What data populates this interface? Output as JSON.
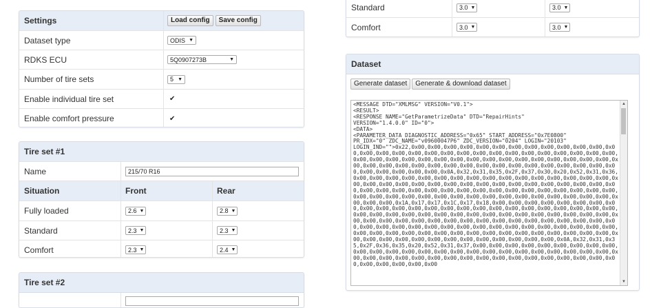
{
  "settings": {
    "title": "Settings",
    "load_label": "Load config",
    "save_label": "Save config",
    "rows": [
      {
        "label": "Dataset type",
        "value": "ODIS",
        "kind": "select"
      },
      {
        "label": "RDKS ECU",
        "value": "5Q0907273B",
        "kind": "select"
      },
      {
        "label": "Number of tire sets",
        "value": "5",
        "kind": "select"
      },
      {
        "label": "Enable individual tire set",
        "value": "✔",
        "kind": "check"
      },
      {
        "label": "Enable comfort pressure",
        "value": "✔",
        "kind": "check"
      }
    ]
  },
  "top_table": {
    "rows": [
      {
        "label": "Standard",
        "front": "3.0",
        "rear": "3.0"
      },
      {
        "label": "Comfort",
        "front": "3.0",
        "rear": "3.0"
      }
    ]
  },
  "tireset1": {
    "title": "Tire set #1",
    "name_label": "Name",
    "name_value": "215/70 R16",
    "col_situation": "Situation",
    "col_front": "Front",
    "col_rear": "Rear",
    "rows": [
      {
        "label": "Fully loaded",
        "front": "2.6",
        "rear": "2.8"
      },
      {
        "label": "Standard",
        "front": "2.3",
        "rear": "2.3"
      },
      {
        "label": "Comfort",
        "front": "2.3",
        "rear": "2.4"
      }
    ]
  },
  "tireset2": {
    "title": "Tire set #2"
  },
  "dataset": {
    "title": "Dataset",
    "generate_label": "Generate dataset",
    "generate_download_label": "Generate & download dataset",
    "content": "<MESSAGE DTD=\"XMLMSG\" VERSION=\"V0.1\">\n<RESULT>\n<RESPONSE NAME=\"GetParametrizeData\" DTD=\"RepairHints\"\nVERSION=\"1.4.0.0\" ID=\"0\">\n<DATA>\n<PARAMETER_DATA DIAGNOSTIC_ADDRESS=\"0x65\" START_ADDRESS=\"0x7E0800\"\nPR_IDX=\"0\" ZDC_NAME=\"v09600047P6\" ZDC_VERSION=\"0204\" LOGIN=\"20103\"\nLOGIN_IND=\"\">0x22,0x00,0x00,0x00,0x00,0x00,0x00,0x00,0x00,0x00,0x00,0x00,0x00,0x00,0x00,0x00,0x00,0x00,0x00,0x00,0x00,0x00,0x00,0x00,0x00,0x00,0x00,0x00,0x00,0x00,0x00,0x00,0x00,0x00,0x00,0x00,0x00,0x00,0x00,0x00,0x00,0x00,0x00,0x00,0x00,0x00,0x00,0x00,0x00,0x00,0x00,0x00,0x00,0x00,0x00,0x00,0x00,0x00,0x00,0x00,0x00,0x00,0x00,0x00,0x00,0x00,0x00,0x00,0x0A,0x32,0x31,0x35,0x2F,0x37,0x30,0x20,0x52,0x31,0x36,0x00,0x00,0x00,0x00,0x00,0x00,0x00,0x00,0x00,0x00,0x00,0x00,0x00,0x00,0x00,0x00,0x00,0x00,0x00,0x00,0x00,0x00,0x00,0x00,0x00,0x00,0x00,0x00,0x00,0x00,0x00,0x00,0x00,0x00,0x00,0x00,0x00,0x00,0x00,0x00,0x00,0x00,0x00,0x00,0x00,0x00,0x00,0x00,0x00,0x00,0x00,0x00,0x00,0x00,0x00,0x00,0x00,0x00,0x00,0x00,0x00,0x00,0x00,0x00,0x00,0x00,0x00,0x00,0x1A,0x17,0x17,0x1C,0x17,0x18,0x00,0x00,0x00,0x00,0x00,0x00,0x00,0x00,0x00,0x00,0x00,0x00,0x00,0x00,0x00,0x00,0x00,0x00,0x00,0x00,0x00,0x00,0x00,0x00,0x00,0x00,0x00,0x00,0x00,0x00,0x00,0x00,0x00,0x00,0x00,0x00,0x00,0x00,0x00,0x00,0x00,0x00,0x00,0x00,0x00,0x00,0x00,0x00,0x00,0x00,0x00,0x00,0x00,0x00,0x00,0x00,0x00,0x00,0x00,0x00,0x00,0x00,0x00,0x00,0x00,0x00,0x00,0x00,0x00,0x00,0x00,0x00,0x00,0x00,0x00,0x00,0x00,0x00,0x00,0x00,0x00,0x00,0x00,0x00,0x00,0x00,0x00,0x00,0x00,0x00,0x00,0x00,0x00,0x00,0x00,0x00,0x00,0x00,0x00,0x00,0x00,0x00,0x0A,0x32,0x31,0x35,0x2F,0x36,0x35,0x20,0x52,0x31,0x37,0x00,0x00,0x00,0x00,0x00,0x00,0x00,0x00,0x00,0x00,0x00,0x00,0x00,0x00,0x00,0x00,0x00,0x00,0x00,0x00,0x00,0x00,0x00,0x00,0x00,0x00,0x00,0x00,0x00,0x00,0x00,0x00,0x00,0x00,0x00,0x00,0x00,0x00,0x00,0x00,0x00,0x00,0x00,0x00,0x00,0x00,0x00"
  }
}
